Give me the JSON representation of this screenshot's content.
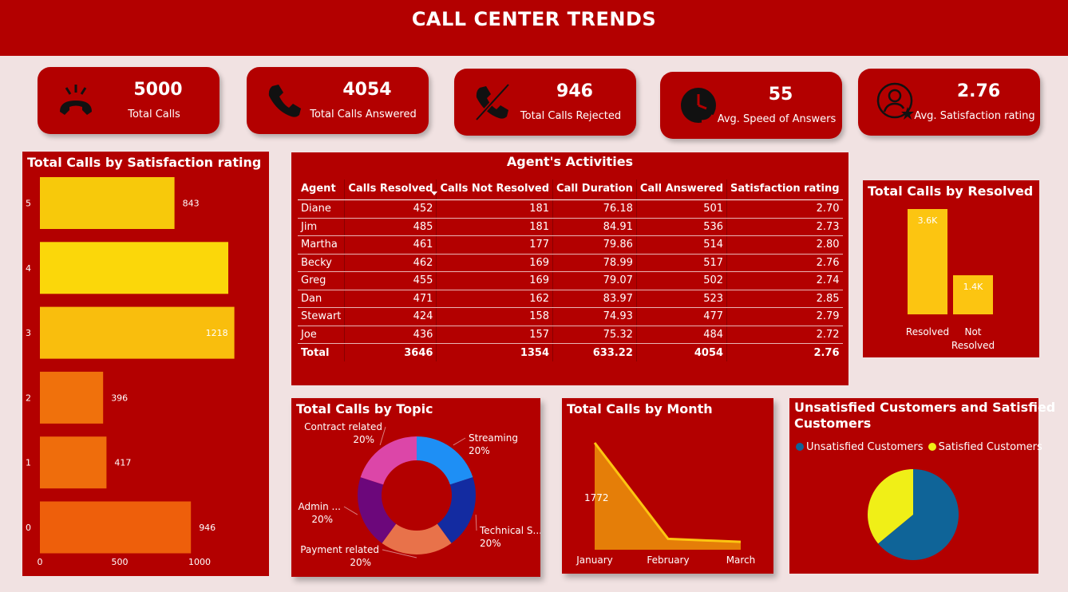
{
  "header": {
    "title": "CALL CENTER TRENDS"
  },
  "kpis": [
    {
      "value": "5000",
      "label": "Total Calls",
      "icon": "phone-ringing-icon"
    },
    {
      "value": "4054",
      "label": "Total Calls Answered",
      "icon": "phone-icon"
    },
    {
      "value": "946",
      "label": "Total Calls Rejected",
      "icon": "phone-crossed-icon"
    },
    {
      "value": "55",
      "label": "Avg. Speed of Answers",
      "icon": "clock-headset-icon"
    },
    {
      "value": "2.76",
      "label": "Avg. Satisfaction rating",
      "icon": "user-star-icon"
    }
  ],
  "colors": {
    "brand": "#b30000",
    "background": "#f1e2e2",
    "yellow": "#fac70f",
    "orange": "#ef6d0c",
    "blue": "#0f6498"
  },
  "satisfaction_panel": {
    "title": "Total Calls by Satisfaction rating"
  },
  "agents_panel": {
    "title": "Agent's Activities",
    "columns": [
      "Agent",
      "Calls Resolved",
      "Calls Not Resolved",
      "Call Duration",
      "Call Answered",
      "Satisfaction rating"
    ],
    "rows": [
      [
        "Diane",
        "452",
        "181",
        "76.18",
        "501",
        "2.70"
      ],
      [
        "Jim",
        "485",
        "181",
        "84.91",
        "536",
        "2.73"
      ],
      [
        "Martha",
        "461",
        "177",
        "79.86",
        "514",
        "2.80"
      ],
      [
        "Becky",
        "462",
        "169",
        "78.99",
        "517",
        "2.76"
      ],
      [
        "Greg",
        "455",
        "169",
        "79.07",
        "502",
        "2.74"
      ],
      [
        "Dan",
        "471",
        "162",
        "83.97",
        "523",
        "2.85"
      ],
      [
        "Stewart",
        "424",
        "158",
        "74.93",
        "477",
        "2.79"
      ],
      [
        "Joe",
        "436",
        "157",
        "75.32",
        "484",
        "2.72"
      ]
    ],
    "total": [
      "Total",
      "3646",
      "1354",
      "633.22",
      "4054",
      "2.76"
    ]
  },
  "resolved_panel": {
    "title": "Total Calls by Resolved"
  },
  "topic_panel": {
    "title": "Total Calls by Topic"
  },
  "month_panel": {
    "title": "Total Calls by Month"
  },
  "sat_unsat_panel": {
    "title_line1": "Unsatisfied Customers and Satisfied",
    "title_line2": "Customers",
    "legend": [
      "Unsatisfied Customers",
      "Satisfied Customers"
    ]
  },
  "chart_data": [
    {
      "type": "bar",
      "orientation": "horizontal",
      "title": "Total Calls by Satisfaction rating",
      "categories": [
        "5",
        "4",
        "3",
        "2",
        "1",
        "0"
      ],
      "values": [
        843,
        1180,
        1218,
        396,
        417,
        946
      ],
      "data_labels": [
        "843",
        "",
        "1218",
        "396",
        "417",
        "946"
      ],
      "xlim": [
        0,
        1200
      ],
      "x_ticks": [
        "0",
        "500",
        "1000"
      ],
      "bar_colors": [
        "#f7c90b",
        "#fbd70a",
        "#f9be0d",
        "#f0710c",
        "#ef6d0c",
        "#ee5f0b"
      ]
    },
    {
      "type": "bar",
      "title": "Total Calls by Resolved",
      "categories": [
        "Resolved",
        "Not Resolved"
      ],
      "category_lines": [
        [
          "Resolved"
        ],
        [
          "Not",
          "Resolved"
        ]
      ],
      "values": [
        3646,
        1354
      ],
      "data_labels": [
        "3.6K",
        "1.4K"
      ],
      "ylim": [
        0,
        4000
      ],
      "color": "#fcc511"
    },
    {
      "type": "pie",
      "style": "donut",
      "title": "Total Calls by Topic",
      "slices": [
        {
          "label": "Streaming",
          "percent": "20%",
          "value": 20,
          "color": "#1e8ff5"
        },
        {
          "label": "Technical S...",
          "percent": "20%",
          "value": 20,
          "color": "#132ba1"
        },
        {
          "label": "Payment related",
          "percent": "20%",
          "value": 20,
          "color": "#e8724a"
        },
        {
          "label": "Admin ...",
          "percent": "20%",
          "value": 20,
          "color": "#6c077b"
        },
        {
          "label": "Contract related",
          "percent": "20%",
          "value": 20,
          "color": "#dc46a8"
        }
      ]
    },
    {
      "type": "area",
      "title": "Total Calls by Month",
      "categories": [
        "January",
        "February",
        "March"
      ],
      "values": [
        1772,
        180,
        130
      ],
      "data_labels": [
        "1772",
        "",
        ""
      ],
      "ylim": [
        0,
        1800
      ],
      "fill": "#e57e08",
      "line": "#fcc511"
    },
    {
      "type": "pie",
      "title": "Unsatisfied Customers and Satisfied Customers",
      "slices": [
        {
          "label": "Unsatisfied Customers",
          "value": 64,
          "color": "#0f6498"
        },
        {
          "label": "Satisfied Customers",
          "value": 36,
          "color": "#f0ef17"
        }
      ]
    }
  ]
}
